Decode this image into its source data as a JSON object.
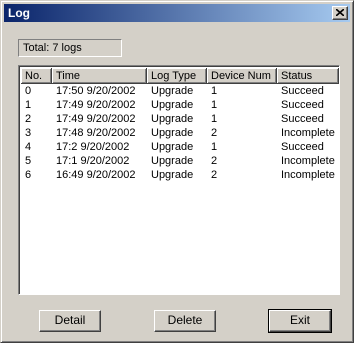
{
  "window": {
    "title": "Log"
  },
  "icons": {
    "close": "close-x-icon"
  },
  "total": "Total: 7 logs",
  "columns": [
    "No.",
    "Time",
    "Log Type",
    "Device Num",
    "Status"
  ],
  "rows": [
    [
      "0",
      "17:50 9/20/2002",
      "Upgrade",
      "1",
      "Succeed"
    ],
    [
      "1",
      "17:49 9/20/2002",
      "Upgrade",
      "1",
      "Succeed"
    ],
    [
      "2",
      "17:49 9/20/2002",
      "Upgrade",
      "1",
      "Succeed"
    ],
    [
      "3",
      "17:48 9/20/2002",
      "Upgrade",
      "2",
      "Incomplete"
    ],
    [
      "4",
      "17:2 9/20/2002",
      "Upgrade",
      "1",
      "Succeed"
    ],
    [
      "5",
      "17:1 9/20/2002",
      "Upgrade",
      "2",
      "Incomplete"
    ],
    [
      "6",
      "16:49 9/20/2002",
      "Upgrade",
      "2",
      "Incomplete"
    ]
  ],
  "buttons": {
    "detail": "Detail",
    "delete": "Delete",
    "exit": "Exit"
  },
  "colors": {
    "titlebar_start": "#0a246a",
    "titlebar_end": "#a6caf0",
    "face": "#d4d0c8"
  }
}
